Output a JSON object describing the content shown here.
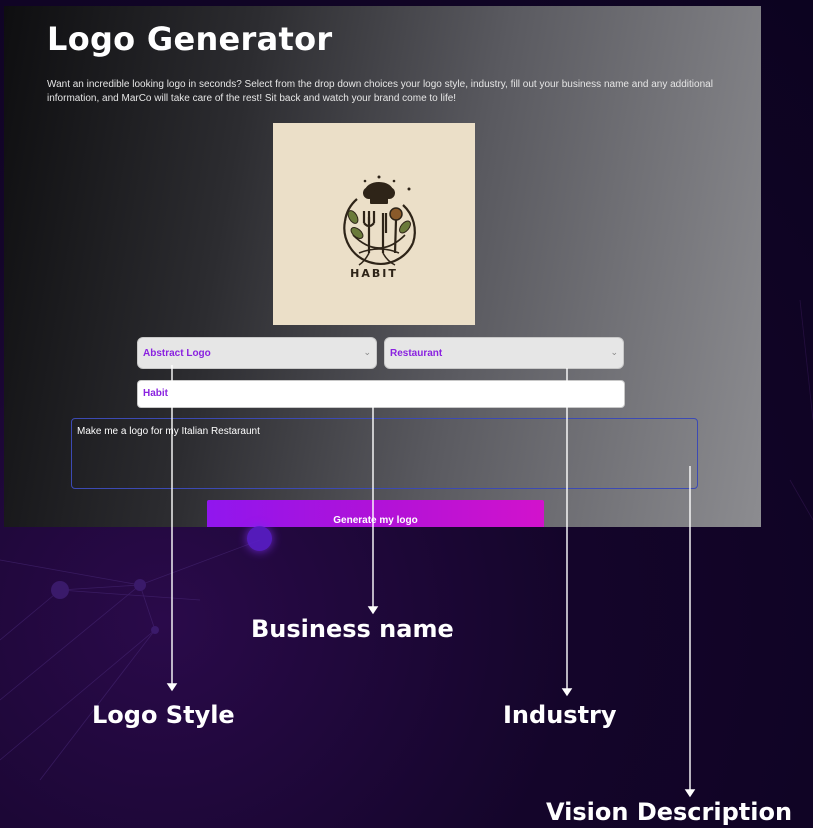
{
  "app": {
    "title": "Logo Generator",
    "description": "Want an incredible looking logo in seconds? Select from the drop down choices your logo style, industry, fill out your business name and any additional information, and MarCo will take care of the rest! Sit back and watch your brand come to life!"
  },
  "preview": {
    "logo_text": "HABIT",
    "icon": "chef-hat-fork-logo-icon",
    "background_color": "#ebdfc8"
  },
  "form": {
    "logo_style": {
      "value": "Abstract Logo"
    },
    "industry": {
      "value": "Restaurant"
    },
    "business_name": {
      "value": "Habit"
    },
    "vision": {
      "value": "Make me a logo for my Italian Restaraunt"
    },
    "generate_label": "Generate my logo"
  },
  "callouts": {
    "business_name": "Business name",
    "logo_style": "Logo Style",
    "industry": "Industry",
    "vision": "Vision Description"
  },
  "colors": {
    "accent_purple": "#8a22e0",
    "button_start": "#9016ee",
    "button_end": "#d212cc",
    "textarea_border": "#3c4ab4"
  }
}
